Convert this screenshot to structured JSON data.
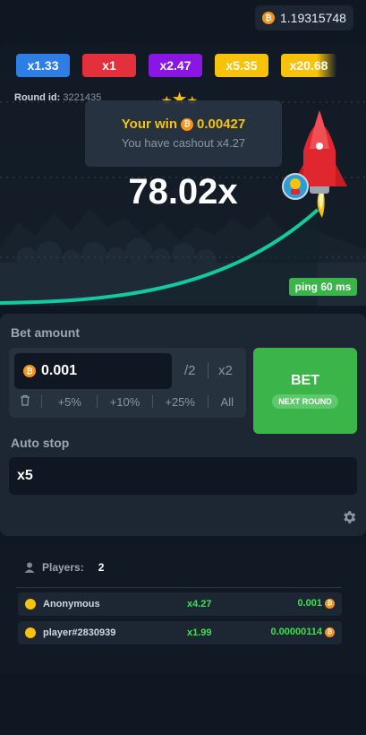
{
  "balance": "1.19315748",
  "recent_multipliers": [
    {
      "label": "x1.33",
      "color": "#2d7fe6"
    },
    {
      "label": "x1",
      "color": "#e3303c"
    },
    {
      "label": "x2.47",
      "color": "#8a16e6"
    },
    {
      "label": "x5.35",
      "color": "#f6c20a"
    },
    {
      "label": "x20.68",
      "color": "#f6c20a"
    }
  ],
  "round": {
    "label": "Round id:",
    "value": "3221435"
  },
  "win_card": {
    "title": "Your win",
    "amount": "0.00427",
    "subtitle": "You have cashout x4.27"
  },
  "current_multiplier": "78.02x",
  "ping": "ping 60 ms",
  "bet": {
    "label": "Bet amount",
    "value": "0.001",
    "half": "/2",
    "double": "x2",
    "clear_icon": "trash-icon",
    "quick": [
      "+5%",
      "+10%",
      "+25%",
      "All"
    ],
    "button": "BET",
    "button_sub": "NEXT ROUND"
  },
  "auto_stop": {
    "label": "Auto stop",
    "value": "x5"
  },
  "players": {
    "label": "Players:",
    "count": "2",
    "rows": [
      {
        "name": "Anonymous",
        "multiplier": "x4.27",
        "win": "0.001"
      },
      {
        "name": "player#2830939",
        "multiplier": "x1.99",
        "win": "0.00000114"
      }
    ]
  },
  "colors": {
    "accent_green": "#3bb54a",
    "win_gold": "#f6c20a",
    "curve": "#13c9a0"
  }
}
